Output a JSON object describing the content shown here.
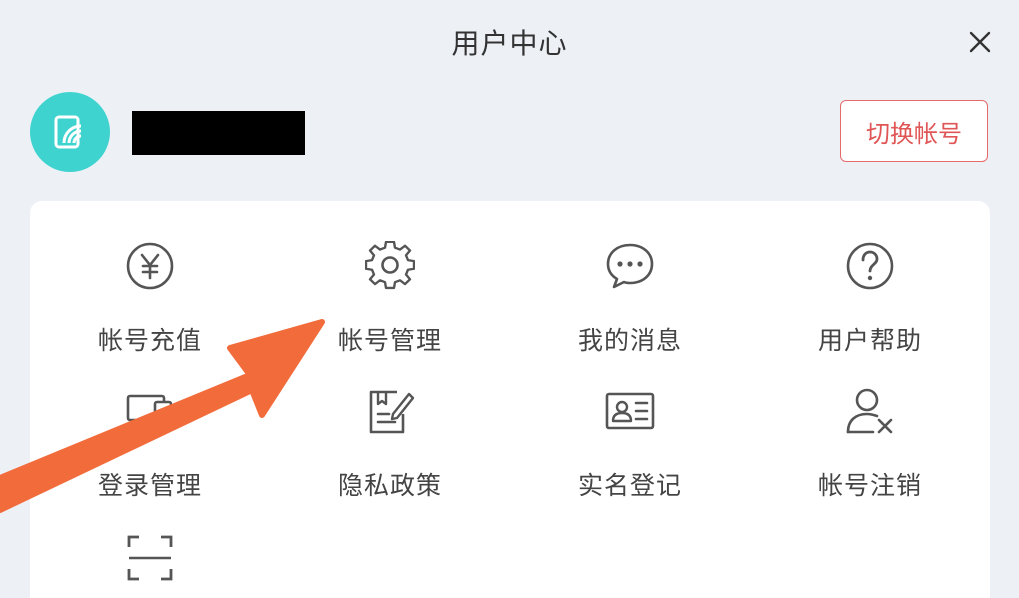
{
  "header": {
    "title": "用户中心"
  },
  "account": {
    "switch_label": "切换帐号"
  },
  "menu": {
    "items": [
      {
        "label": "帐号充值",
        "icon": "yen-icon"
      },
      {
        "label": "帐号管理",
        "icon": "gear-icon"
      },
      {
        "label": "我的消息",
        "icon": "chat-bubble-icon"
      },
      {
        "label": "用户帮助",
        "icon": "question-icon"
      },
      {
        "label": "登录管理",
        "icon": "devices-icon"
      },
      {
        "label": "隐私政策",
        "icon": "document-edit-icon"
      },
      {
        "label": "实名登记",
        "icon": "id-card-icon"
      },
      {
        "label": "帐号注销",
        "icon": "user-remove-icon"
      },
      {
        "label": "",
        "icon": "scan-icon"
      }
    ]
  },
  "colors": {
    "accent": "#e05555",
    "avatar_bg": "#3fd3cf",
    "arrow": "#f26b3a",
    "icon": "#555555"
  }
}
